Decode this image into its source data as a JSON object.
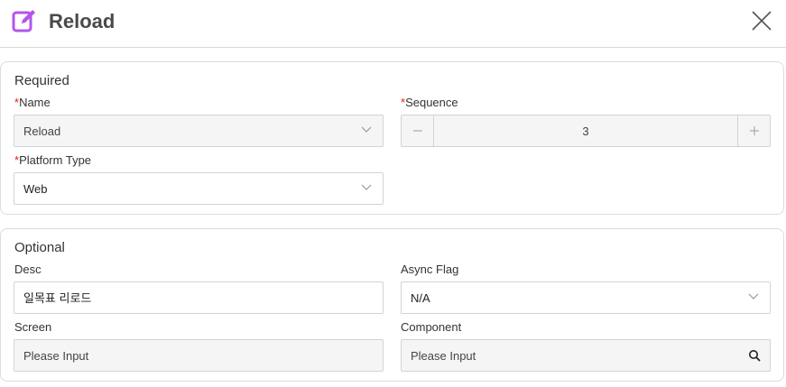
{
  "dialog": {
    "title": "Reload",
    "header_icon": "edit-icon",
    "close_icon": "close-icon",
    "accent_color": "#b455e8"
  },
  "required": {
    "section_title": "Required",
    "required_marker": "*",
    "name": {
      "label": "Name",
      "value": "Reload"
    },
    "sequence": {
      "label": "Sequence",
      "value": "3"
    },
    "platform_type": {
      "label": "Platform Type",
      "value": "Web"
    }
  },
  "optional": {
    "section_title": "Optional",
    "desc": {
      "label": "Desc",
      "value": "일목표 리로드"
    },
    "async_flag": {
      "label": "Async Flag",
      "value": "N/A"
    },
    "screen": {
      "label": "Screen",
      "placeholder": "Please Input"
    },
    "component": {
      "label": "Component",
      "placeholder": "Please Input"
    }
  }
}
